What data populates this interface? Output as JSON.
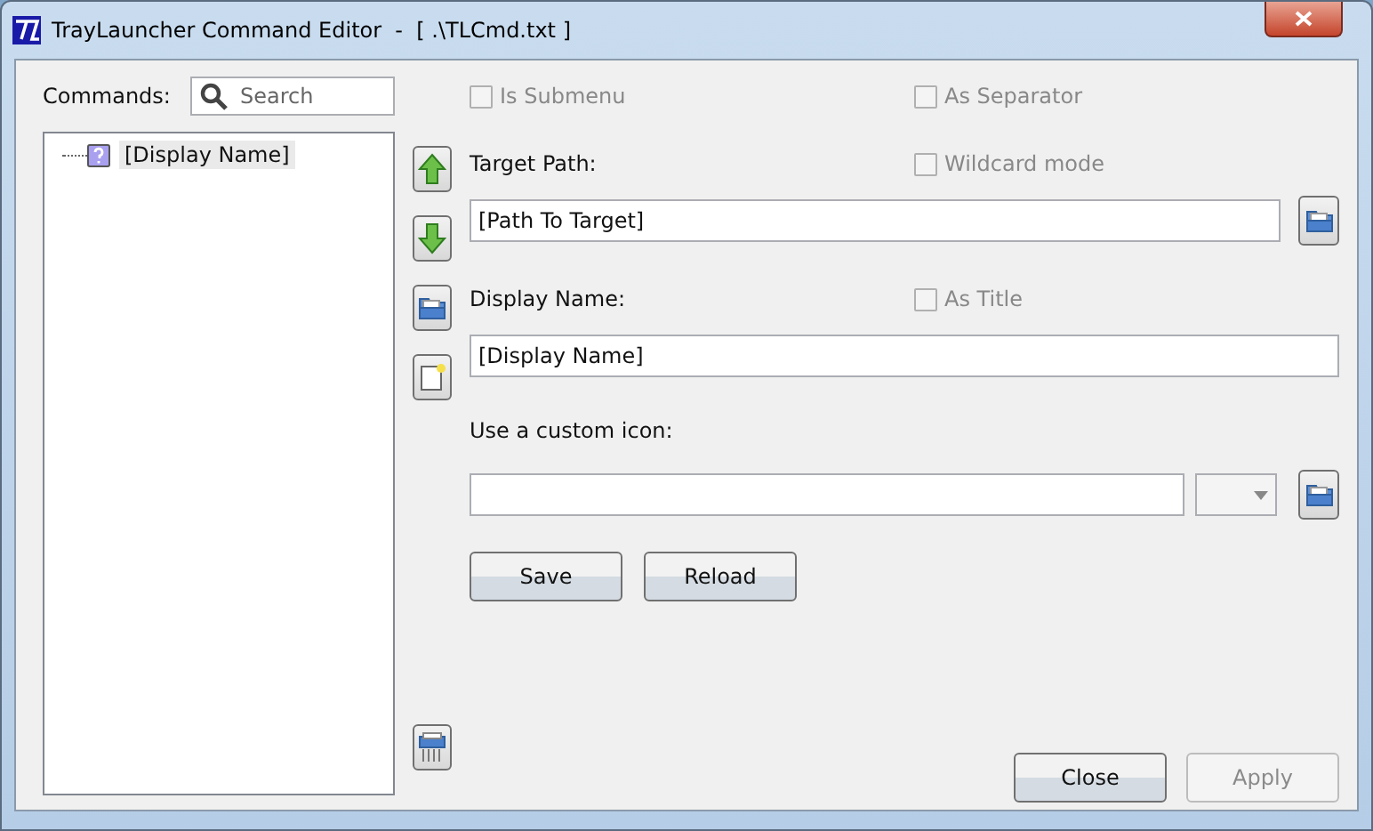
{
  "window": {
    "title": "TrayLauncher Command Editor  -  [ .\\TLCmd.txt ]"
  },
  "commands": {
    "label": "Commands:",
    "search": {
      "placeholder": "Search"
    },
    "tree": [
      {
        "label": "[Display Name]",
        "selected": true
      }
    ]
  },
  "options": {
    "is_submenu": {
      "label": "Is Submenu",
      "checked": false,
      "disabled": true
    },
    "as_separator": {
      "label": "As Separator",
      "checked": false,
      "disabled": true
    }
  },
  "target_path": {
    "label": "Target Path:",
    "value": "[Path To Target]",
    "wildcard": {
      "label": "Wildcard mode",
      "checked": false,
      "disabled": true
    }
  },
  "display_name": {
    "label": "Display Name:",
    "value": "[Display Name]",
    "as_title": {
      "label": "As Title",
      "checked": false,
      "disabled": true
    }
  },
  "custom_icon": {
    "label": "Use a custom icon:"
  },
  "buttons": [
    {
      "label": "Save",
      "disabled": false
    },
    {
      "label": "Reload",
      "disabled": false
    }
  ],
  "footer_buttons": [
    {
      "label": "Close",
      "disabled": false
    },
    {
      "label": "Apply",
      "disabled": true
    }
  ]
}
